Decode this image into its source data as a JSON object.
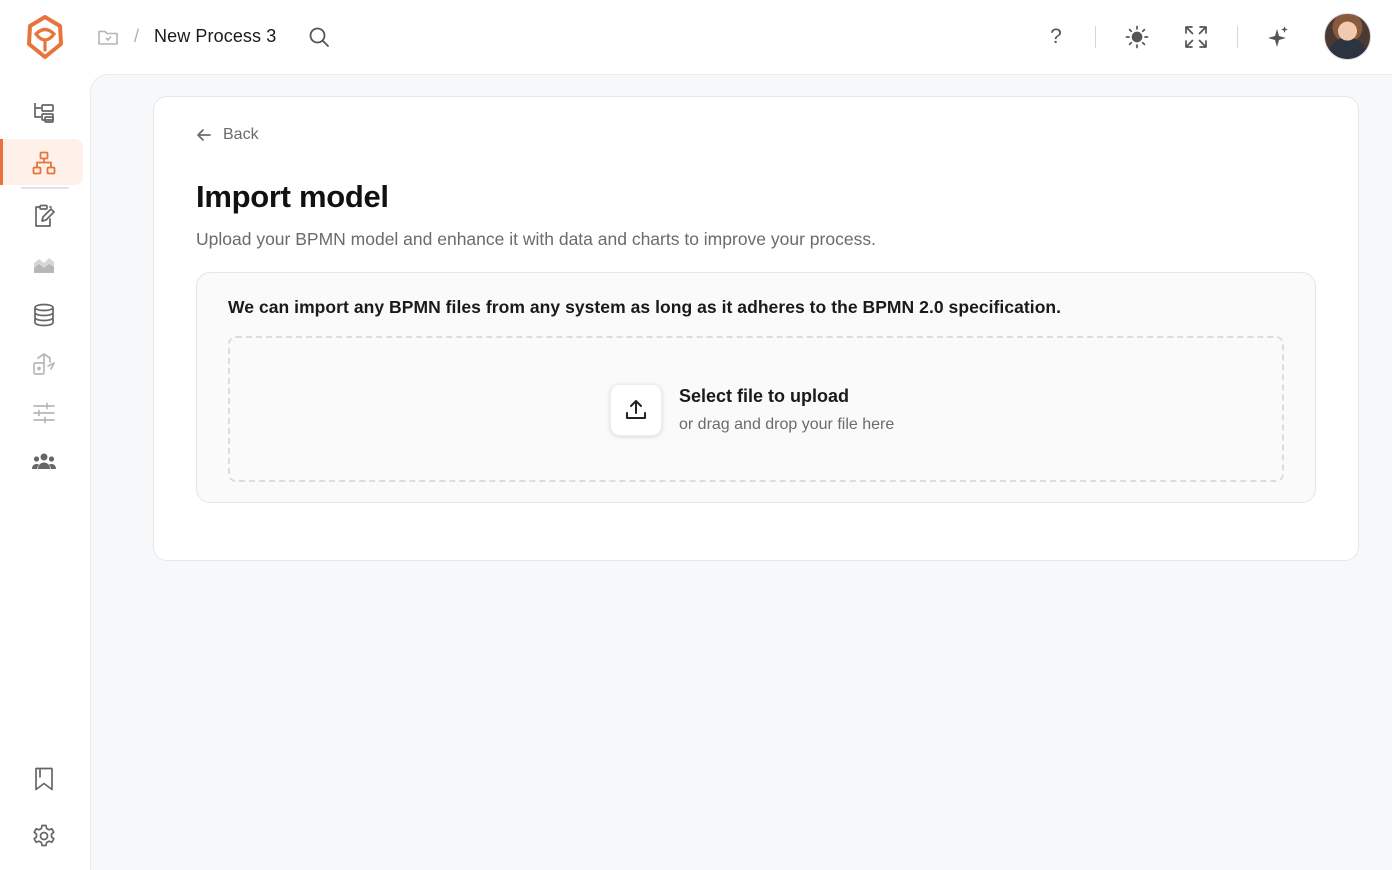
{
  "header": {
    "breadcrumb_separator": "/",
    "process_title": "New Process 3",
    "help_label": "?",
    "icons": [
      "folder-icon",
      "search-icon",
      "sun-icon",
      "expand-icon",
      "sparkles-icon"
    ]
  },
  "sidebar": {
    "items": [
      {
        "icon": "hierarchy-icon",
        "state": "normal"
      },
      {
        "icon": "sitemap-icon",
        "state": "active"
      },
      {
        "icon": "clipboard-edit-icon",
        "state": "normal"
      },
      {
        "icon": "chart-mountain-icon",
        "state": "dim"
      },
      {
        "icon": "database-icon",
        "state": "normal"
      },
      {
        "icon": "export-icon",
        "state": "dim"
      },
      {
        "icon": "sliders-icon",
        "state": "dim"
      },
      {
        "icon": "users-icon",
        "state": "normal"
      }
    ],
    "bottom_items": [
      {
        "icon": "bookmark-icon"
      },
      {
        "icon": "gear-icon"
      }
    ]
  },
  "colors": {
    "accent": "#e8743b",
    "background": "#f7f8fa"
  },
  "page": {
    "back_label": "Back",
    "title": "Import model",
    "subtitle": "Upload your BPMN model and enhance it with data and charts to improve your process."
  },
  "import": {
    "note": "We can import any BPMN files from any system as long as it adheres to the BPMN 2.0 specification.",
    "dropzone_title": "Select file to upload",
    "dropzone_subtitle": "or drag and drop your file here"
  }
}
